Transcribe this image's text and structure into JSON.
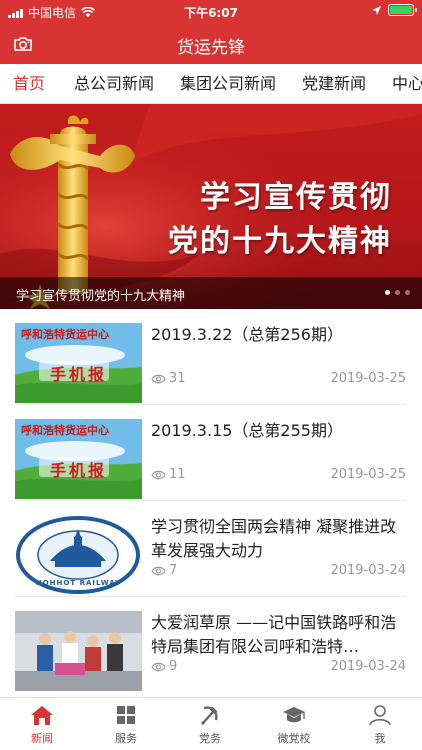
{
  "status_bar": {
    "carrier": "中国电信",
    "time": "下午6:07"
  },
  "header": {
    "title": "货运先锋",
    "left_icon": "camera-icon"
  },
  "tabs": [
    {
      "label": "首页",
      "active": true
    },
    {
      "label": "总公司新闻"
    },
    {
      "label": "集团公司新闻"
    },
    {
      "label": "党建新闻"
    },
    {
      "label": "中心"
    }
  ],
  "banner": {
    "headline_line1": "学习宣传贯彻",
    "headline_line2": "党的十九大精神",
    "caption": "学习宣传贯彻党的十九大精神",
    "slide_count": 3,
    "active_slide": 1
  },
  "news": [
    {
      "title": "2019.3.22（总第256期）",
      "views": "31",
      "date": "2019-03-25",
      "thumb_top_text": "呼和浩特货运中心",
      "thumb_main_text": "手机报"
    },
    {
      "title": "2019.3.15（总第255期）",
      "views": "11",
      "date": "2019-03-25",
      "thumb_top_text": "呼和浩特货运中心",
      "thumb_main_text": "手机报"
    },
    {
      "title": "学习贯彻全国两会精神 凝聚推进改革发展强大动力",
      "views": "7",
      "date": "2019-03-24",
      "thumb_logo_text": "HOHHOT RAILWAY"
    },
    {
      "title": "大爱润草原 ——记中国铁路呼和浩特局集团有限公司呼和浩特…",
      "views": "9",
      "date": "2019-03-24"
    }
  ],
  "bottom_tabs": [
    {
      "label": "新闻",
      "icon": "home-icon",
      "active": true
    },
    {
      "label": "服务",
      "icon": "grid-icon"
    },
    {
      "label": "党务",
      "icon": "hammer-sickle-icon"
    },
    {
      "label": "微党校",
      "icon": "graduation-cap-icon"
    },
    {
      "label": "我",
      "icon": "person-icon"
    }
  ],
  "colors": {
    "brand_red": "#d83434",
    "text_gray": "#999999"
  }
}
